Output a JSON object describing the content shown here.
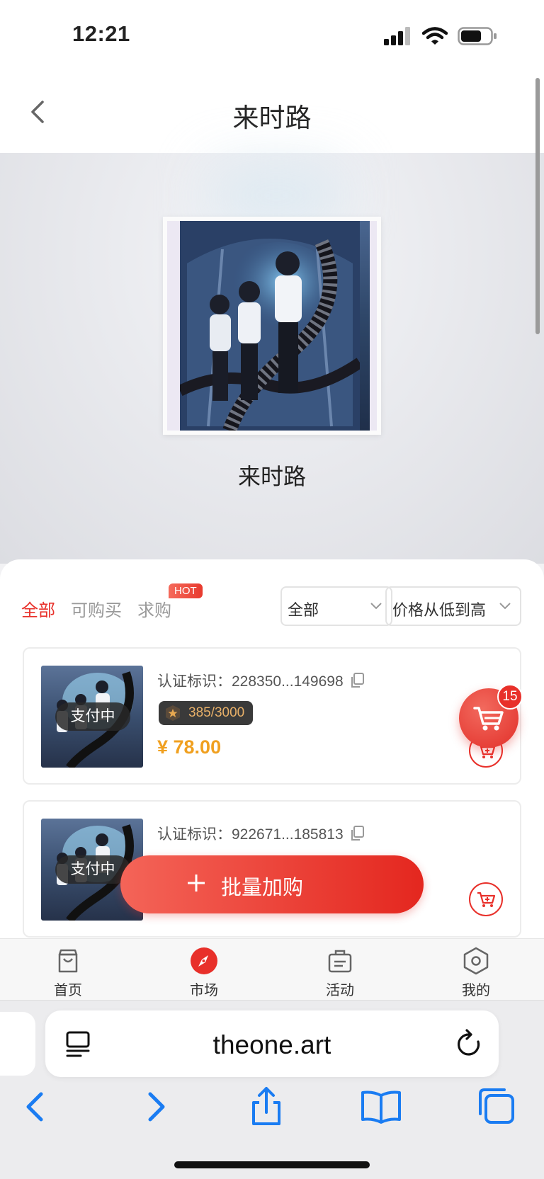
{
  "status_bar": {
    "time": "12:21"
  },
  "header": {
    "title": "来时路"
  },
  "hero": {
    "name": "来时路"
  },
  "market": {
    "tabs": [
      {
        "label": "全部",
        "active": true
      },
      {
        "label": "可购买",
        "active": false
      },
      {
        "label": "求购",
        "active": false
      }
    ],
    "hot_badge": "HOT",
    "filter_select": {
      "value": "全部"
    },
    "sort_select": {
      "value": "价格从低到高"
    },
    "listings": [
      {
        "status": "支付中",
        "cert_label": "认证标识：",
        "cert_id": "228350...149698",
        "serial": "385/3000",
        "price": "¥ 78.00"
      },
      {
        "status": "支付中",
        "cert_label": "认证标识：",
        "cert_id": "922671...185813"
      }
    ],
    "cart_count": "15",
    "batch_button": {
      "label": "批量加购"
    }
  },
  "tabbar": {
    "items": [
      {
        "label": "首页",
        "icon": "bag-icon"
      },
      {
        "label": "市场",
        "icon": "compass-icon"
      },
      {
        "label": "活动",
        "icon": "briefcase-icon"
      },
      {
        "label": "我的",
        "icon": "hexagon-icon"
      }
    ]
  },
  "browser": {
    "url": "theone.art"
  },
  "colors": {
    "accent": "#e8302a",
    "price": "#f0a020",
    "serial_text": "#e8b068"
  }
}
